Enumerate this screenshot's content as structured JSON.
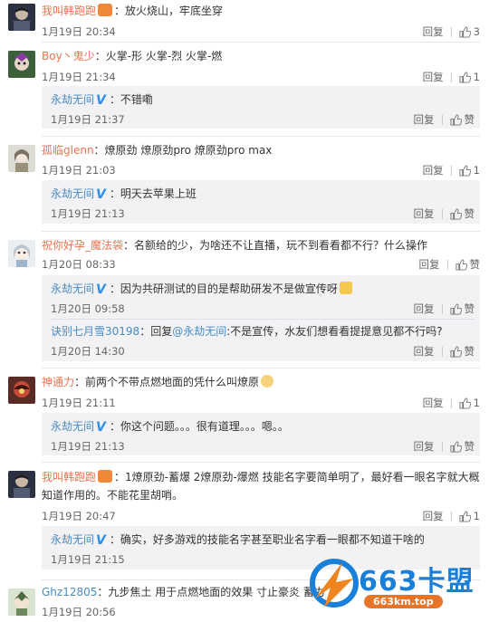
{
  "labels": {
    "reply": "回复",
    "like": "赞"
  },
  "icons": {
    "like": "thumbs-up-icon",
    "verified": "V"
  },
  "colors": {
    "username": "#eb7350",
    "link": "#4a8bc2",
    "verified": "#2f8fe8",
    "reply_bg": "#f2f2f5"
  },
  "comments": [
    {
      "user": "我叫韩跑跑",
      "text": "：放火烧山，牢底坐穿",
      "time": "1月19日 20:34",
      "likes": "3"
    },
    {
      "user": "Boy丶鬼少",
      "text": "：火掌-形 火掌-烈 火掌-燃",
      "time": "1月19日 21:34",
      "likes": "1",
      "reply": {
        "user": "永劫无间",
        "text": "：不错嘞",
        "time": "1月19日 21:37"
      }
    },
    {
      "user": "孤临glenn",
      "text": "：燎原劲 燎原劲pro 燎原劲pro max",
      "time": "1月19日 21:03",
      "likes": "1",
      "reply": {
        "user": "永劫无间",
        "text": "：明天去苹果上班",
        "time": "1月19日 21:13"
      }
    },
    {
      "user": "祝你好孕_魔法袋",
      "text": "：名额给的少，为啥还不让直播，玩不到看看都不行？什么操作",
      "time": "1月20日 08:33",
      "replies": [
        {
          "user": "永劫无间",
          "text": "：因为共研测试的目的是帮助研发不是做宣传呀",
          "time": "1月20日 09:58"
        },
        {
          "user": "诀别七月雪30198",
          "prefix": "：回复",
          "mention": "@永劫无间",
          "text": ":不是宣传，水友们想看看提提意见都不行吗?",
          "time": "1月20日 14:30"
        }
      ]
    },
    {
      "user": "神通力",
      "text": "：前两个不带点燃地面的凭什么叫燎原",
      "time": "1月19日 21:11",
      "likes": "1",
      "reply": {
        "user": "永劫无间",
        "text": "：你这个问题。。。很有道理。。。嗯。。",
        "time": "1月19日 21:13"
      }
    },
    {
      "user": "我叫韩跑跑",
      "text": "：1燎原劲-蓄爆 2燎原劲-爆燃 技能名字要简单明了，最好看一眼名字就大概知道作用的。不能花里胡哨。",
      "time": "1月19日 20:47",
      "likes": "1",
      "reply": {
        "user": "永劫无间",
        "text": "：确实，好多游戏的技能名字甚至职业名字看一眼都不知道干啥的",
        "time": "1月19日 21:15"
      }
    },
    {
      "user": "Ghz12805",
      "text": "：九步焦土   用于点燃地面的效果   寸止豪炎   蓄力",
      "time": "1月19日 20:56"
    }
  ],
  "watermark": {
    "brand": "663卡盟",
    "url": "663km.top"
  }
}
